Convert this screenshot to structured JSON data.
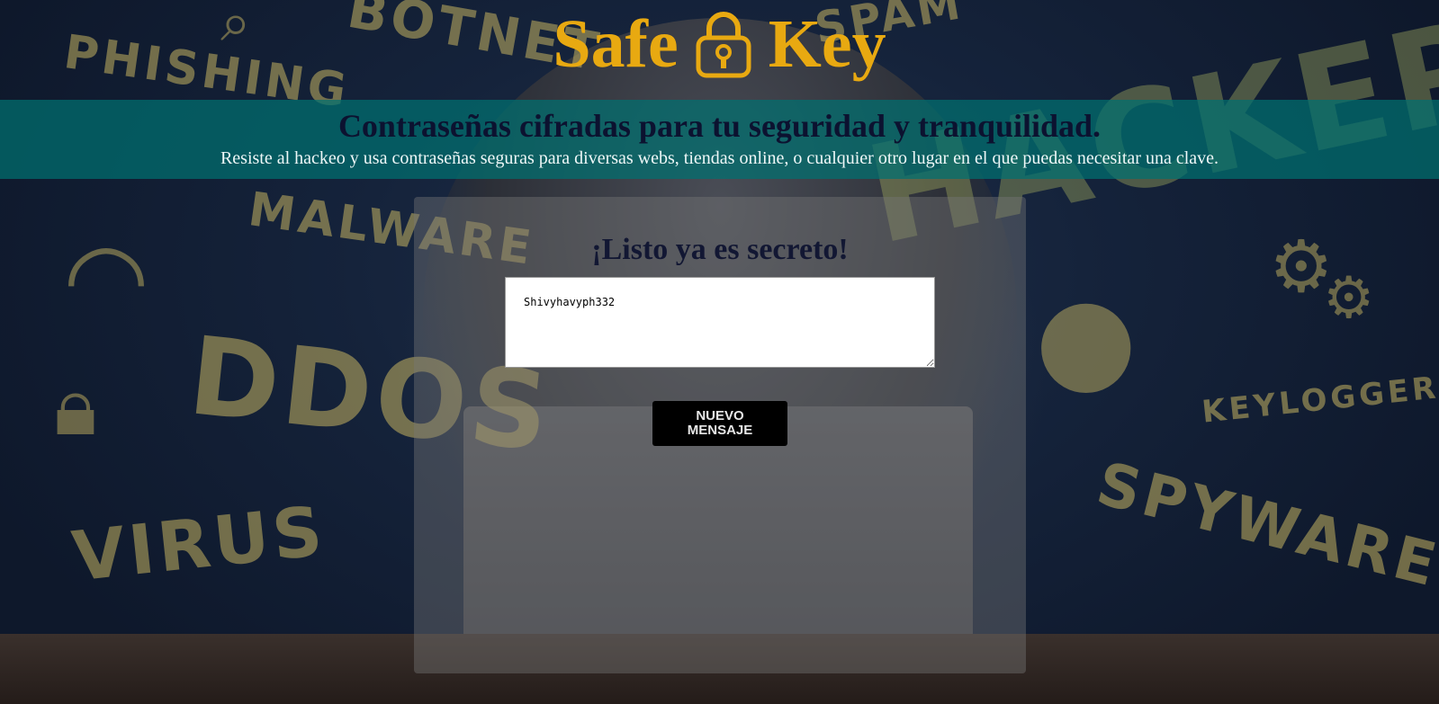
{
  "brand": {
    "word1": "Safe",
    "word2": "Key",
    "icon": "padlock-icon",
    "color": "#e8a911"
  },
  "banner": {
    "headline": "Contraseñas cifradas para tu seguridad y tranquilidad.",
    "subtitle": "Resiste al hackeo y usa contraseñas seguras para diversas webs, tiendas online, o cualquier otro lugar en el que puedas necesitar una clave.",
    "color": "#007070"
  },
  "panel": {
    "title": "¡Listo ya es secreto!",
    "textarea_value": "Shivyhavyph332",
    "button_label": "NUEVO MENSAJE"
  },
  "background": {
    "words": [
      "PHISHING",
      "BOTNET",
      "SPAM",
      "HACKER",
      "MALWARE",
      "DDOS",
      "VIRUS",
      "KEYLOGGER",
      "SPYWARE"
    ]
  }
}
